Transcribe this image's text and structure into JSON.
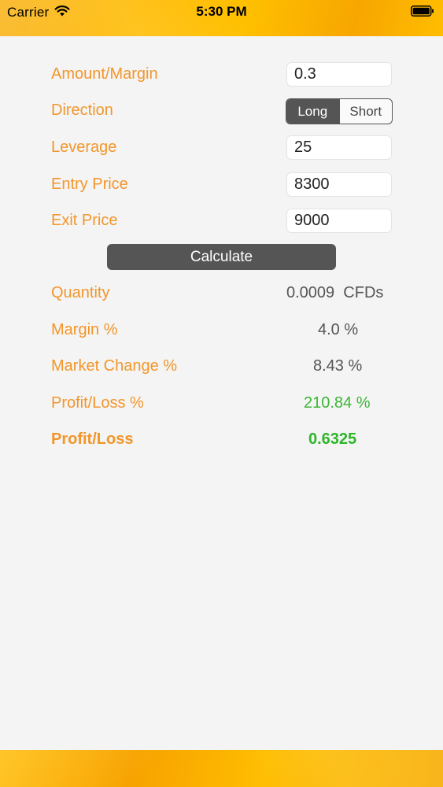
{
  "status_bar": {
    "carrier": "Carrier",
    "time": "5:30 PM"
  },
  "form": {
    "amount_margin": {
      "label": "Amount/Margin",
      "value": "0.3"
    },
    "direction": {
      "label": "Direction",
      "options": [
        "Long",
        "Short"
      ],
      "selected": "Long"
    },
    "leverage": {
      "label": "Leverage",
      "value": "25"
    },
    "entry_price": {
      "label": "Entry Price",
      "value": "8300"
    },
    "exit_price": {
      "label": "Exit Price",
      "value": "9000"
    }
  },
  "calculate_label": "Calculate",
  "results": {
    "quantity": {
      "label": "Quantity",
      "value": "0.0009  CFDs"
    },
    "margin_pct": {
      "label": "Margin %",
      "value": "4.0 %"
    },
    "market_change_pct": {
      "label": "Market Change %",
      "value": "8.43 %"
    },
    "profit_loss_pct": {
      "label": "Profit/Loss %",
      "value": "210.84 %"
    },
    "profit_loss": {
      "label": "Profit/Loss",
      "value": "0.6325"
    }
  },
  "colors": {
    "accent_orange": "#f2962b",
    "bar_orange": "#ffb600",
    "profit_green": "#3cb534",
    "button_gray": "#555555"
  },
  "icons": {
    "wifi": "wifi-icon",
    "battery": "battery-icon"
  }
}
